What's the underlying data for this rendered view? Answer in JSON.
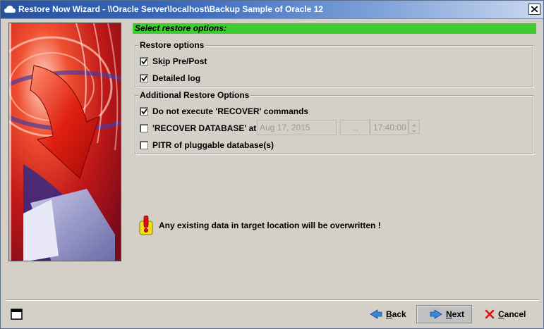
{
  "window": {
    "title": "Restore Now Wizard - \\\\Oracle Server\\localhost\\Backup Sample of Oracle 12"
  },
  "header": {
    "title": "Select restore options:",
    "color": "#3fcc30"
  },
  "restore_options": {
    "title": "Restore options",
    "items": [
      {
        "pre": "Sk",
        "mnemonic": "i",
        "post": "p Pre/Post",
        "checked": true
      },
      {
        "pre": "Detailed lo",
        "mnemonic": "g",
        "post": "",
        "checked": true
      }
    ]
  },
  "additional_options": {
    "title": "Additional Restore Options",
    "do_not_recover": {
      "label": "Do not execute 'RECOVER' commands",
      "checked": true
    },
    "recover_database": {
      "label": "'RECOVER DATABASE' at:",
      "checked": false,
      "date_value": "Aug 17, 2015",
      "browse_label": "...",
      "time_value": "17:40:00"
    },
    "pitr": {
      "label": "PITR of pluggable database(s)",
      "checked": false
    }
  },
  "warning": {
    "text": "Any existing data in target location will be overwritten !",
    "icon": "warning-icon"
  },
  "buttons": {
    "back": {
      "mnemonic": "B",
      "rest": "ack",
      "icon": "back-arrow-icon"
    },
    "next": {
      "mnemonic": "N",
      "rest": "ext",
      "icon": "next-arrow-icon"
    },
    "cancel": {
      "mnemonic": "C",
      "rest": "ancel",
      "icon": "cancel-x-icon"
    }
  }
}
